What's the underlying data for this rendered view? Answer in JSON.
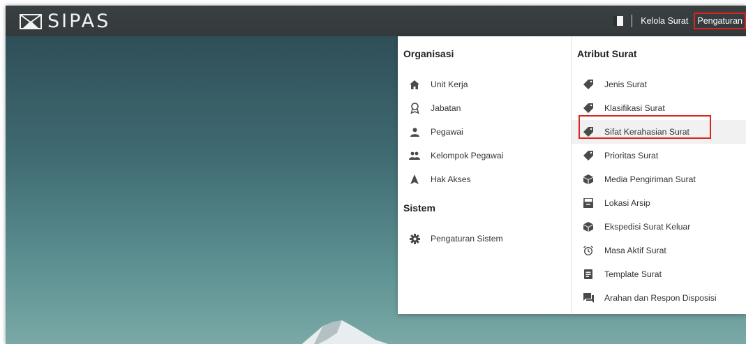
{
  "brand": {
    "name": "SIPAS"
  },
  "nav": {
    "kelola_label": "Kelola Surat",
    "pengaturan_label": "Pengaturan"
  },
  "menu": {
    "organisasi": {
      "title": "Organisasi",
      "items": [
        {
          "label": "Unit Kerja",
          "icon": "home-icon"
        },
        {
          "label": "Jabatan",
          "icon": "award-icon"
        },
        {
          "label": "Pegawai",
          "icon": "person-icon"
        },
        {
          "label": "Kelompok Pegawai",
          "icon": "group-icon"
        },
        {
          "label": "Hak Akses",
          "icon": "navigation-icon"
        }
      ]
    },
    "sistem": {
      "title": "Sistem",
      "items": [
        {
          "label": "Pengaturan Sistem",
          "icon": "gear-icon"
        }
      ]
    },
    "atribut": {
      "title": "Atribut Surat",
      "items": [
        {
          "label": "Jenis Surat",
          "icon": "tag-icon"
        },
        {
          "label": "Klasifikasi Surat",
          "icon": "tag-icon"
        },
        {
          "label": "Sifat Kerahasian Surat",
          "icon": "tag-icon"
        },
        {
          "label": "Prioritas Surat",
          "icon": "tag-icon"
        },
        {
          "label": "Media Pengiriman Surat",
          "icon": "box-icon"
        },
        {
          "label": "Lokasi Arsip",
          "icon": "archive-icon"
        },
        {
          "label": "Ekspedisi Surat Keluar",
          "icon": "box-icon"
        },
        {
          "label": "Masa Aktif Surat",
          "icon": "alarm-icon"
        },
        {
          "label": "Template Surat",
          "icon": "document-icon"
        },
        {
          "label": "Arahan dan Respon Disposisi",
          "icon": "chat-icon"
        }
      ]
    }
  },
  "colors": {
    "topbar": "#3a3f42",
    "highlight": "#d9241f",
    "icon": "#4a4a4a"
  }
}
